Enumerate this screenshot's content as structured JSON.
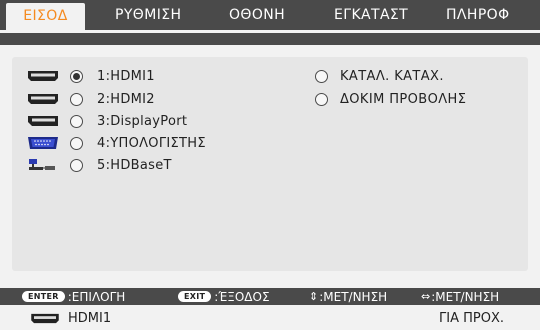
{
  "tabs": [
    {
      "label": "ΕΙΣΟΔ",
      "active": true
    },
    {
      "label": "ΡΥΘΜΙΣΗ",
      "active": false
    },
    {
      "label": "ΟΘΟΝΗ",
      "active": false
    },
    {
      "label": "ΕΓΚΑΤΑΣΤ",
      "active": false
    },
    {
      "label": "ΠΛΗΡΟΦ",
      "active": false
    }
  ],
  "inputs": [
    {
      "label": "1:HDMI1",
      "icon": "hdmi-icon",
      "selected": true
    },
    {
      "label": "2:HDMI2",
      "icon": "hdmi-icon",
      "selected": false
    },
    {
      "label": "3:DisplayPort",
      "icon": "displayport-icon",
      "selected": false
    },
    {
      "label": "4:ΥΠΟΛΟΓΙΣΤΗΣ",
      "icon": "computer-vga-icon",
      "selected": false
    },
    {
      "label": "5:HDBaseT",
      "icon": "hdbaset-icon",
      "selected": false
    }
  ],
  "extra_options": [
    {
      "label": "ΚΑΤΑΛ. ΚΑΤΑΧ.",
      "selected": false
    },
    {
      "label": "ΔΟΚΙΜ ΠΡΟΒΟΛΗΣ",
      "selected": false
    }
  ],
  "footer": {
    "enter_key": "ENTER",
    "enter_label": ":ΕΠΙΛΟΓΗ",
    "exit_key": "EXIT",
    "exit_label": ":ΈΞΟΔΟΣ",
    "updown_label": ":ΜΕΤ/ΝΗΣΗ",
    "leftright_label": ":ΜΕΤ/ΝΗΣΗ",
    "current_input": "HDMI1",
    "current_input_icon": "hdmi-icon",
    "right_text": "ΓΙΑ ΠΡΟΧ."
  },
  "colors": {
    "active_tab_text": "#f58a1f",
    "bar_dark": "#4a4a4a",
    "background": "#f2f2f2",
    "panel": "#e6e6e6"
  }
}
